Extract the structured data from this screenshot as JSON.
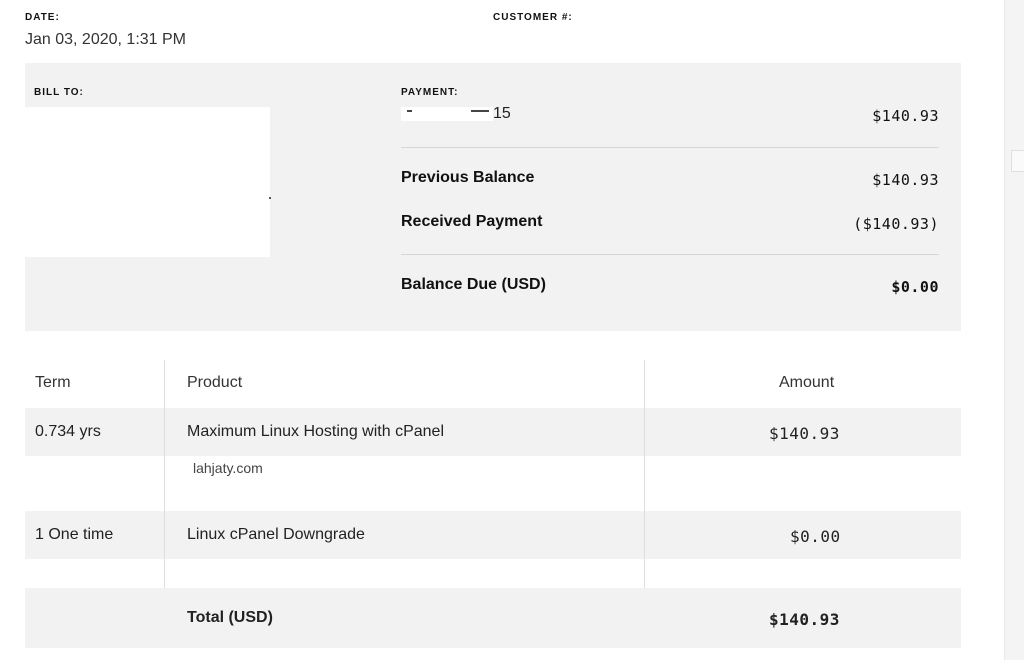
{
  "header": {
    "date_label": "DATE:",
    "date_value": "Jan 03, 2020, 1:31 PM",
    "customer_label": "CUSTOMER #:"
  },
  "bill": {
    "bill_to_label": "BILL TO:",
    "payment_label": "PAYMENT:",
    "payment_method_visible": "15",
    "payment_amount": "$140.93",
    "previous_balance_label": "Previous Balance",
    "previous_balance_value": "$140.93",
    "received_payment_label": "Received Payment",
    "received_payment_value": "($140.93)",
    "balance_due_label": "Balance Due (USD)",
    "balance_due_value": "$0.00"
  },
  "items": {
    "headers": {
      "term": "Term",
      "product": "Product",
      "amount": "Amount"
    },
    "rows": [
      {
        "term": "0.734 yrs",
        "product": "Maximum Linux Hosting with cPanel",
        "detail": "lahjaty.com",
        "amount": "$140.93"
      },
      {
        "term": "1 One time",
        "product": "Linux cPanel Downgrade",
        "detail": "",
        "amount": "$0.00"
      }
    ],
    "total_label": "Total (USD)",
    "total_value": "$140.93"
  }
}
